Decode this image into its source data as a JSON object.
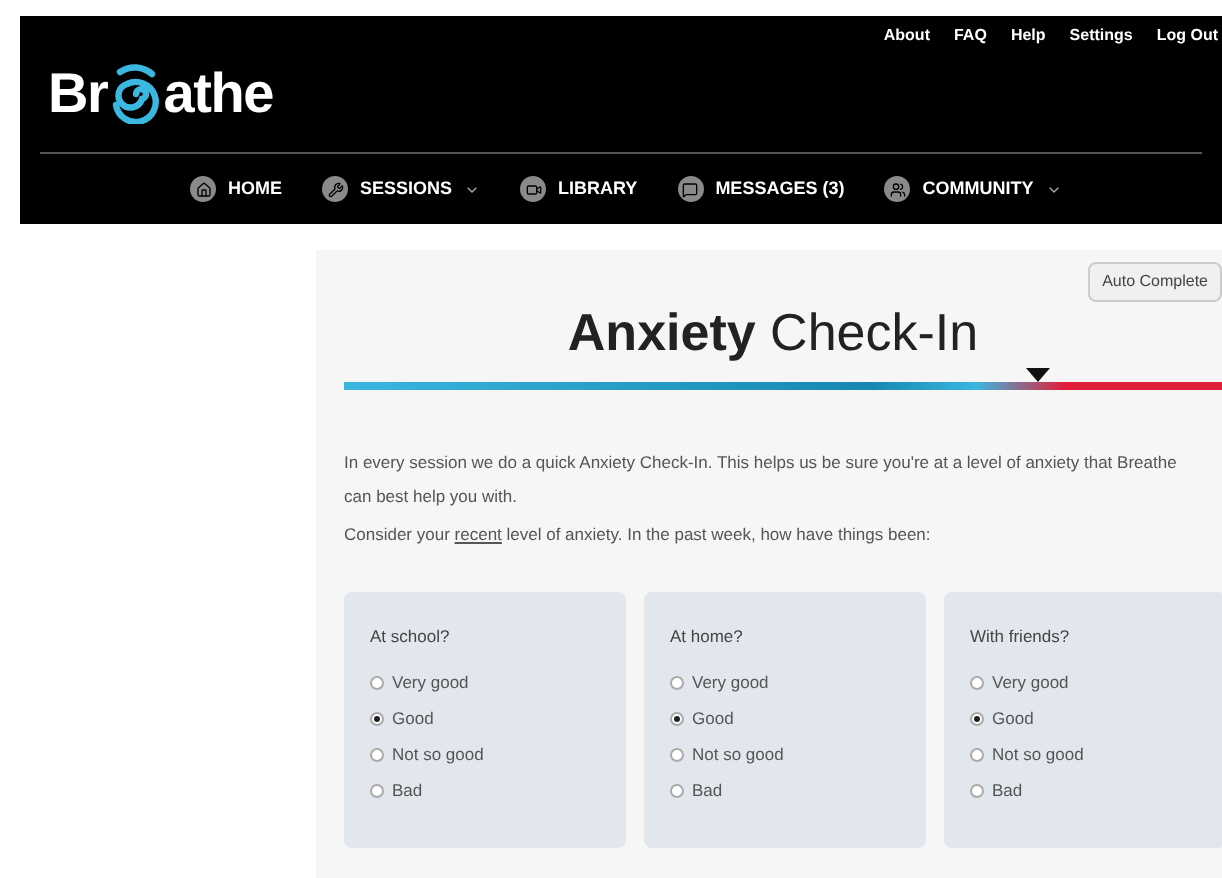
{
  "header": {
    "logo": [
      "Br",
      "athe"
    ],
    "top_links": [
      "About",
      "FAQ",
      "Help",
      "Settings",
      "Log Out"
    ],
    "nav": [
      {
        "label": "HOME",
        "kind": "home",
        "dropdown": false
      },
      {
        "label": "SESSIONS",
        "kind": "wrench",
        "dropdown": true
      },
      {
        "label": "LIBRARY",
        "kind": "video",
        "dropdown": false
      },
      {
        "label": "MESSAGES (3)",
        "kind": "chat",
        "dropdown": false
      },
      {
        "label": "COMMUNITY",
        "kind": "people",
        "dropdown": true
      }
    ]
  },
  "auto_complete_button": "Auto Complete",
  "title": "**Anxiety** Check-In",
  "anxiety_meter": {
    "level": 0.79
  },
  "intro": "In every session we do a quick Anxiety Check-In. This helps us be sure you're at a level of anxiety that Breathe can best help you with.",
  "prompt": {
    "before": "Consider your ",
    "underlined": "recent",
    "after": " level of anxiety. In the past week, how have things been:"
  },
  "questions": [
    {
      "label": "At school?",
      "options": [
        {
          "label": "Very good",
          "selected": false
        },
        {
          "label": "Good",
          "selected": true
        },
        {
          "label": "Not so good",
          "selected": false
        },
        {
          "label": "Bad",
          "selected": false
        }
      ]
    },
    {
      "label": "At home?",
      "options": [
        {
          "label": "Very good",
          "selected": false
        },
        {
          "label": "Good",
          "selected": true
        },
        {
          "label": "Not so good",
          "selected": false
        },
        {
          "label": "Bad",
          "selected": false
        }
      ]
    },
    {
      "label": "With friends?",
      "options": [
        {
          "label": "Very good",
          "selected": false
        },
        {
          "label": "Good",
          "selected": true
        },
        {
          "label": "Not so good",
          "selected": false
        },
        {
          "label": "Bad",
          "selected": false
        }
      ]
    }
  ]
}
